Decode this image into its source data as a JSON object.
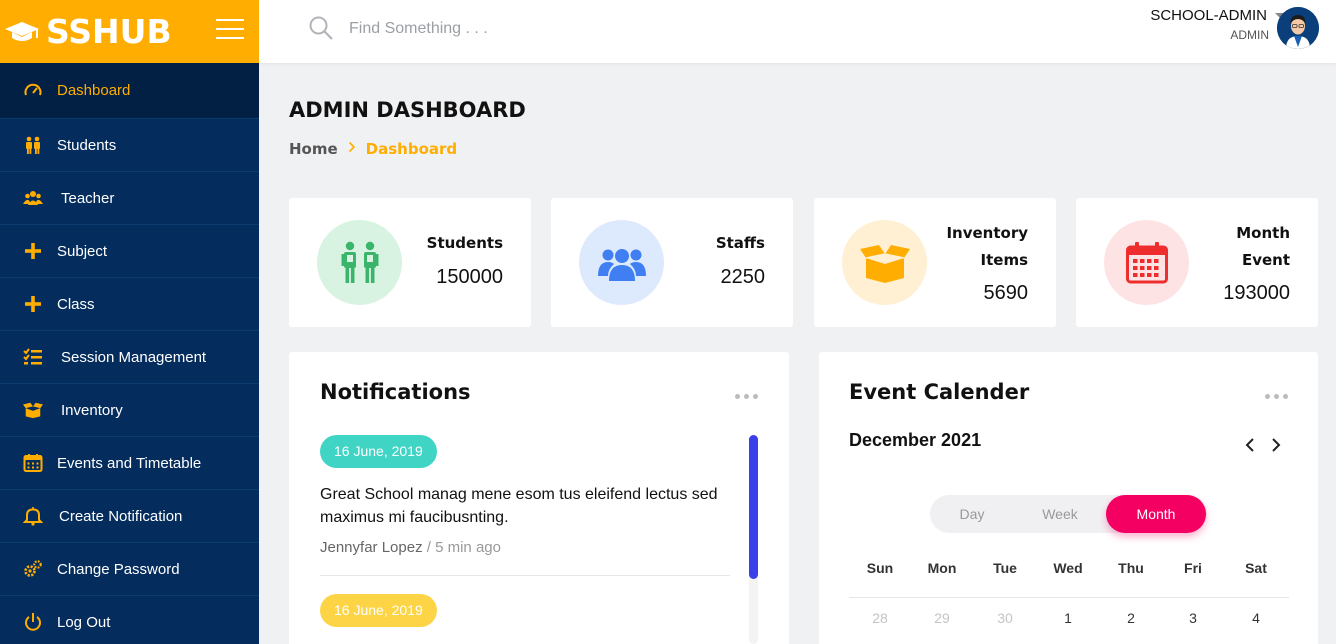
{
  "app": {
    "logo_text": "SSHUB",
    "colors": {
      "accent": "#ffae01",
      "sidebar": "#042c5c",
      "sidebar_active": "#021f44",
      "month_active": "#f40062"
    }
  },
  "sidebar": {
    "items": [
      {
        "label": "Dashboard",
        "icon": "gauge-icon",
        "active": true
      },
      {
        "label": "Students",
        "icon": "students-icon"
      },
      {
        "label": "Teacher",
        "icon": "users-icon"
      },
      {
        "label": "Subject",
        "icon": "plus-icon"
      },
      {
        "label": "Class",
        "icon": "plus-icon"
      },
      {
        "label": "Session Management",
        "icon": "list-check-icon"
      },
      {
        "label": "Inventory",
        "icon": "box-icon"
      },
      {
        "label": "Events and Timetable",
        "icon": "calendar-icon"
      },
      {
        "label": "Create Notification",
        "icon": "bell-icon"
      },
      {
        "label": "Change Password",
        "icon": "gears-icon"
      },
      {
        "label": "Log Out",
        "icon": "power-icon"
      }
    ]
  },
  "header": {
    "search_placeholder": "Find Something . . .",
    "user_name": "SCHOOL-ADMIN",
    "user_role": "ADMIN"
  },
  "main": {
    "title": "ADMIN DASHBOARD",
    "breadcrumb": {
      "home": "Home",
      "current": "Dashboard"
    }
  },
  "stats": [
    {
      "label_line1": "Students",
      "label_line2": "",
      "value": "150000",
      "icon": "students-icon",
      "icon_color": "#3bb56b",
      "bg": "#d8f3e2"
    },
    {
      "label_line1": "Staffs",
      "label_line2": "",
      "value": "2250",
      "icon": "users-icon",
      "icon_color": "#3f7ff2",
      "bg": "#dde9fd"
    },
    {
      "label_line1": "Inventory",
      "label_line2": "Items",
      "value": "5690",
      "icon": "box-icon",
      "icon_color": "#ffae01",
      "bg": "#fff0d4"
    },
    {
      "label_line1": "Month",
      "label_line2": "Event",
      "value": "193000",
      "icon": "calendar-icon",
      "icon_color": "#ee2e2e",
      "bg": "#fde3e3"
    }
  ],
  "notifications": {
    "title": "Notifications",
    "items": [
      {
        "date": "16 June, 2019",
        "date_color": "#40d4c4",
        "text": "Great School manag mene esom tus eleifend lectus sed maximus mi faucibusnting.",
        "author": "Jennyfar Lopez",
        "time": "5 min ago"
      },
      {
        "date": "16 June, 2019",
        "date_color": "#fdd445"
      }
    ]
  },
  "calendar": {
    "title": "Event Calender",
    "month_label": "December 2021",
    "views": [
      "Day",
      "Week",
      "Month"
    ],
    "active_view": "Month",
    "weekdays": [
      "Sun",
      "Mon",
      "Tue",
      "Wed",
      "Thu",
      "Fri",
      "Sat"
    ],
    "first_row": [
      "28",
      "29",
      "30",
      "1",
      "2",
      "3",
      "4"
    ]
  }
}
